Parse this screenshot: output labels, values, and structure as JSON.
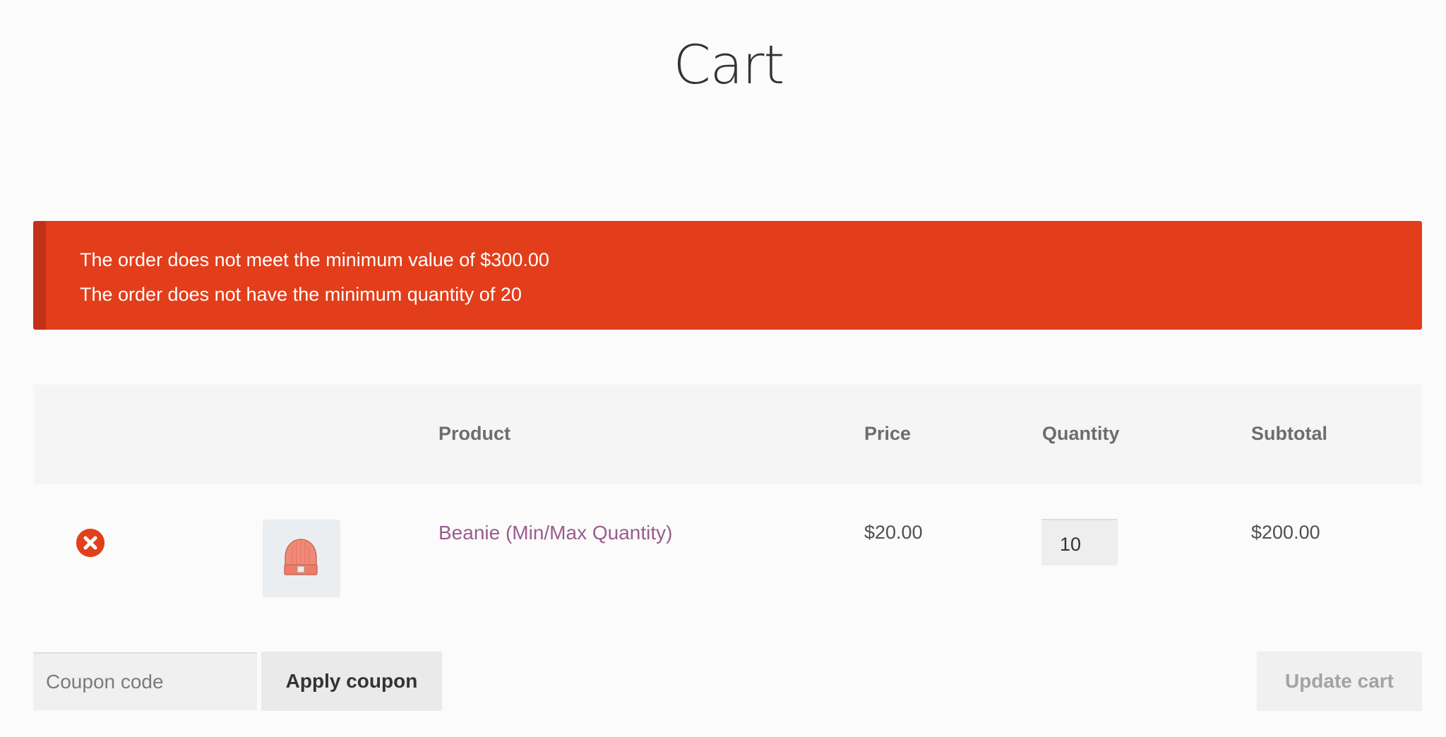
{
  "page": {
    "title": "Cart"
  },
  "notices": {
    "color": "#e23e1b",
    "messages": [
      "The order does not meet the minimum value of $300.00",
      "The order does not have the minimum quantity of 20"
    ]
  },
  "table": {
    "headers": {
      "product": "Product",
      "price": "Price",
      "quantity": "Quantity",
      "subtotal": "Subtotal"
    },
    "rows": [
      {
        "product_name": "Beanie (Min/Max Quantity)",
        "price": "$20.00",
        "quantity": "10",
        "subtotal": "$200.00",
        "thumbnail_icon": "beanie-icon",
        "remove_icon": "remove-circle-x-icon"
      }
    ]
  },
  "coupon": {
    "placeholder": "Coupon code",
    "value": "",
    "apply_label": "Apply coupon"
  },
  "actions": {
    "update_label": "Update cart"
  },
  "colors": {
    "accent_link": "#9b5c8f",
    "error": "#e2401c"
  }
}
